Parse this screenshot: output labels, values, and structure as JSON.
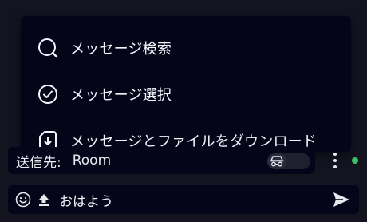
{
  "menu": {
    "items": [
      {
        "label": "メッセージ検索",
        "icon": "search-icon"
      },
      {
        "label": "メッセージ選択",
        "icon": "check-circle-icon"
      },
      {
        "label": "メッセージとファイルをダウンロード",
        "icon": "download-file-icon"
      }
    ]
  },
  "recipient": {
    "label": "送信先:",
    "value": "Room",
    "toggle_icon": "incognito-icon"
  },
  "composer": {
    "text": "おはよう",
    "emoji_icon": "emoji-icon",
    "upload_icon": "upload-icon",
    "send_icon": "send-icon"
  },
  "colors": {
    "background": "#141421",
    "panel": "#05051a",
    "status": "#3bbf62"
  }
}
